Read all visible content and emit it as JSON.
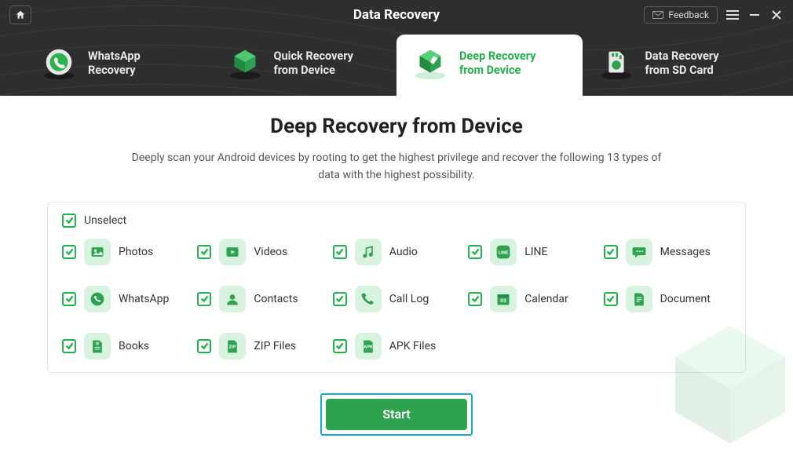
{
  "header": {
    "title": "Data Recovery",
    "feedback_label": "Feedback"
  },
  "tabs": [
    {
      "line1": "WhatsApp",
      "line2": "Recovery",
      "icon": "whatsapp-tab"
    },
    {
      "line1": "Quick Recovery",
      "line2": "from Device",
      "icon": "quick-tab"
    },
    {
      "line1": "Deep Recovery",
      "line2": "from Device",
      "icon": "deep-tab"
    },
    {
      "line1": "Data Recovery",
      "line2": "from SD Card",
      "icon": "sd-tab"
    }
  ],
  "active_tab_index": 2,
  "page": {
    "title": "Deep Recovery from Device",
    "description": "Deeply scan your Android devices by rooting to get the highest privilege and recover the following 13 types of data with the highest possibility."
  },
  "select_all": {
    "label": "Unselect",
    "checked": true
  },
  "items": [
    {
      "label": "Photos",
      "icon": "photos-icon",
      "checked": true
    },
    {
      "label": "Videos",
      "icon": "videos-icon",
      "checked": true
    },
    {
      "label": "Audio",
      "icon": "audio-icon",
      "checked": true
    },
    {
      "label": "LINE",
      "icon": "line-icon",
      "checked": true
    },
    {
      "label": "Messages",
      "icon": "messages-icon",
      "checked": true
    },
    {
      "label": "WhatsApp",
      "icon": "whatsapp-icon",
      "checked": true
    },
    {
      "label": "Contacts",
      "icon": "contacts-icon",
      "checked": true
    },
    {
      "label": "Call Log",
      "icon": "calllog-icon",
      "checked": true
    },
    {
      "label": "Calendar",
      "icon": "calendar-icon",
      "checked": true
    },
    {
      "label": "Document",
      "icon": "document-icon",
      "checked": true
    },
    {
      "label": "Books",
      "icon": "books-icon",
      "checked": true
    },
    {
      "label": "ZIP Files",
      "icon": "zip-icon",
      "checked": true
    },
    {
      "label": "APK Files",
      "icon": "apk-icon",
      "checked": true
    }
  ],
  "start_button": "Start",
  "colors": {
    "accent": "#22b24c",
    "start_bg": "#2fa24f",
    "focus_ring": "#1aa7e0"
  }
}
